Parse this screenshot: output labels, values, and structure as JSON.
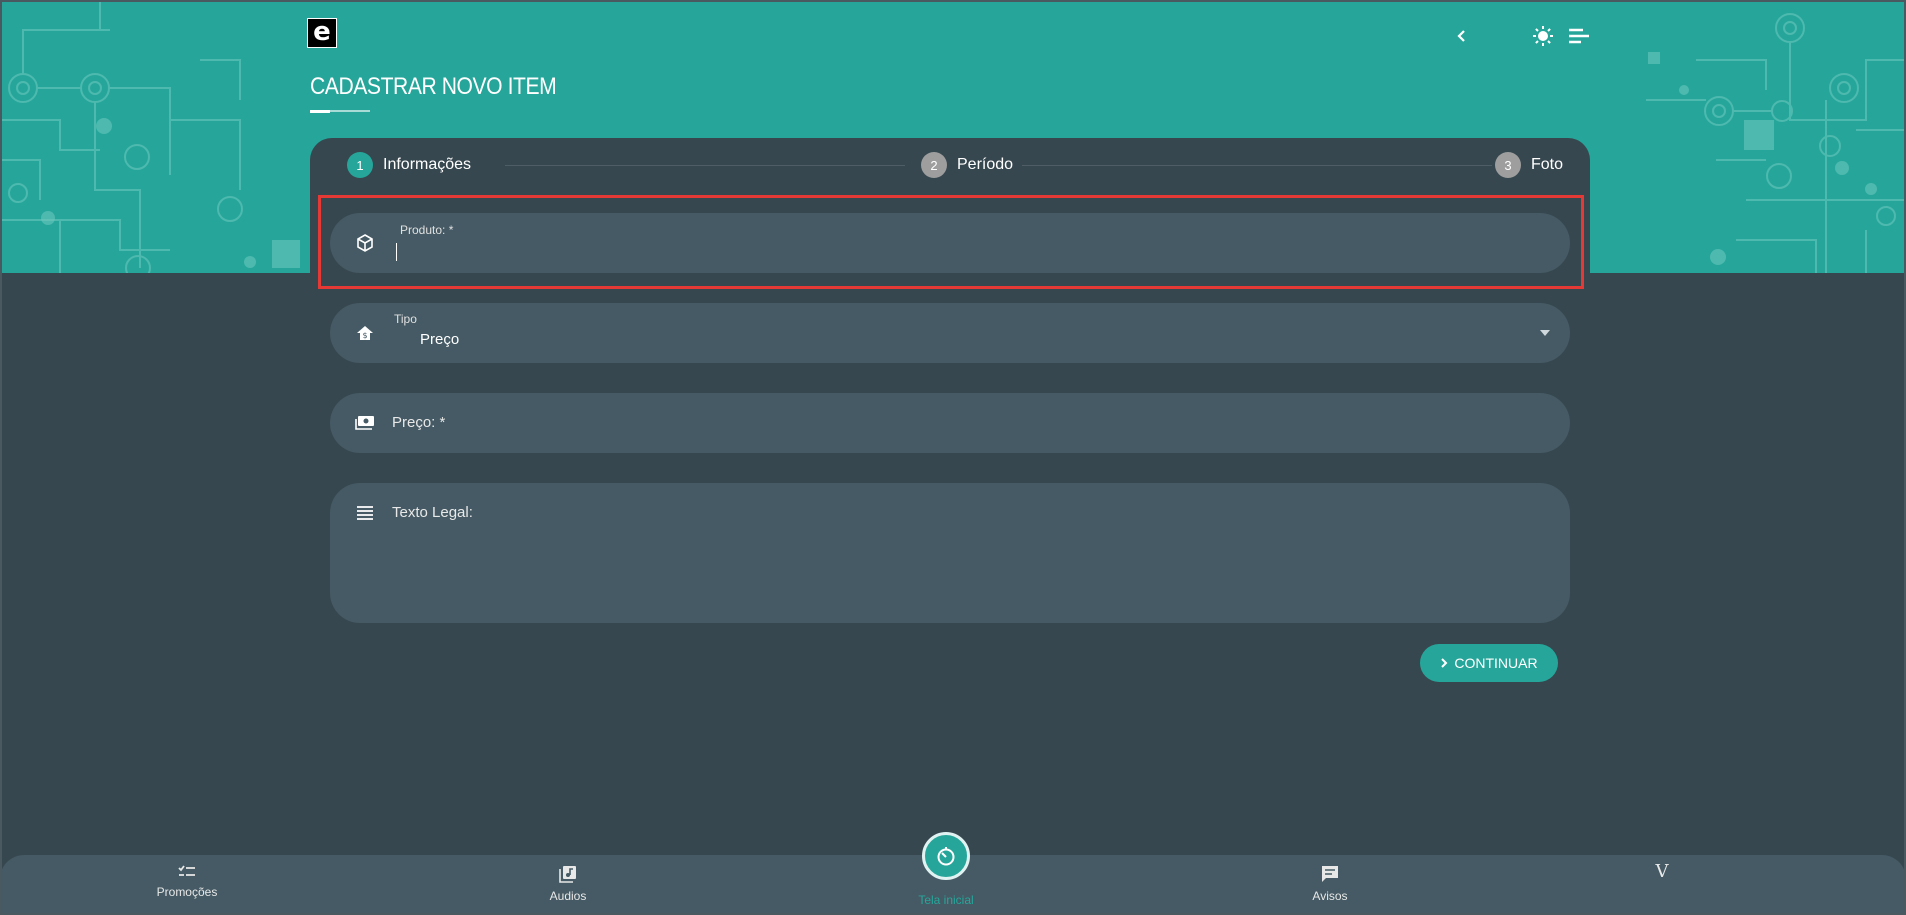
{
  "app": {
    "logo_letter": "e"
  },
  "header": {
    "title": "CADASTRAR NOVO ITEM",
    "back_icon": "chevron-left-icon",
    "theme_icon": "brightness-icon",
    "menu_icon": "menu-icon"
  },
  "stepper": {
    "steps": [
      {
        "number": "1",
        "label": "Informações",
        "active": true
      },
      {
        "number": "2",
        "label": "Período",
        "active": false
      },
      {
        "number": "3",
        "label": "Foto",
        "active": false
      }
    ]
  },
  "form": {
    "produto": {
      "label": "Produto: *",
      "value": "",
      "icon": "box-icon"
    },
    "tipo": {
      "label": "Tipo",
      "value": "Preço",
      "icon": "tag-home-icon"
    },
    "preco": {
      "label": "Preço: *",
      "value": "",
      "icon": "cash-icon"
    },
    "texto_legal": {
      "label": "Texto Legal:",
      "value": "",
      "icon": "text-lines-icon"
    }
  },
  "actions": {
    "continue_label": "CONTINUAR"
  },
  "bottom_nav": {
    "items": [
      {
        "label": "Promoções",
        "icon": "checklist-icon"
      },
      {
        "label": "Audios",
        "icon": "music-library-icon"
      },
      {
        "label": "Tela inicial",
        "icon": "timer-icon",
        "active": true
      },
      {
        "label": "Avisos",
        "icon": "chat-icon"
      },
      {
        "label": "",
        "icon": "v-icon"
      }
    ]
  },
  "colors": {
    "accent": "#26a69a",
    "background": "#37474f",
    "field": "#455a64",
    "highlight": "#e53935"
  }
}
